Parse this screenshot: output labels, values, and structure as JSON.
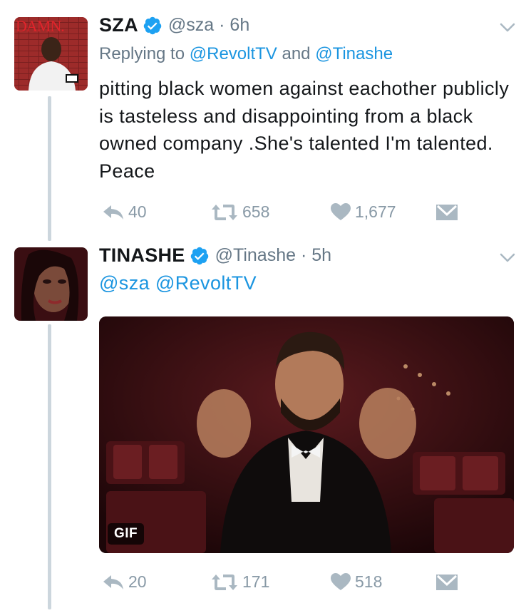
{
  "tweets": [
    {
      "name": "SZA",
      "handle": "@sza",
      "time": "6h",
      "replying_prefix": "Replying to",
      "replying_user1": "@RevoltTV",
      "replying_and": "and",
      "replying_user2": "@Tinashe",
      "text": "pitting black women against eachother publicly is tasteless and disappointing from a black owned company .She's talented I'm talented. Peace",
      "replies": "40",
      "retweets": "658",
      "likes": "1,677",
      "avatar_label": "DAMN."
    },
    {
      "name": "TINASHE",
      "handle": "@Tinashe",
      "time": "5h",
      "mention1": "@sza",
      "mention2": "@RevoltTV",
      "media_badge": "GIF",
      "replies": "20",
      "retweets": "171",
      "likes": "518"
    }
  ],
  "colors": {
    "link": "#1b95e0",
    "secondary": "#657786",
    "action": "#8899a6",
    "thread_line": "#ccd6dd"
  },
  "icons": [
    "verified-icon",
    "chevron-down-icon",
    "reply-icon",
    "retweet-icon",
    "like-icon",
    "direct-message-icon"
  ]
}
